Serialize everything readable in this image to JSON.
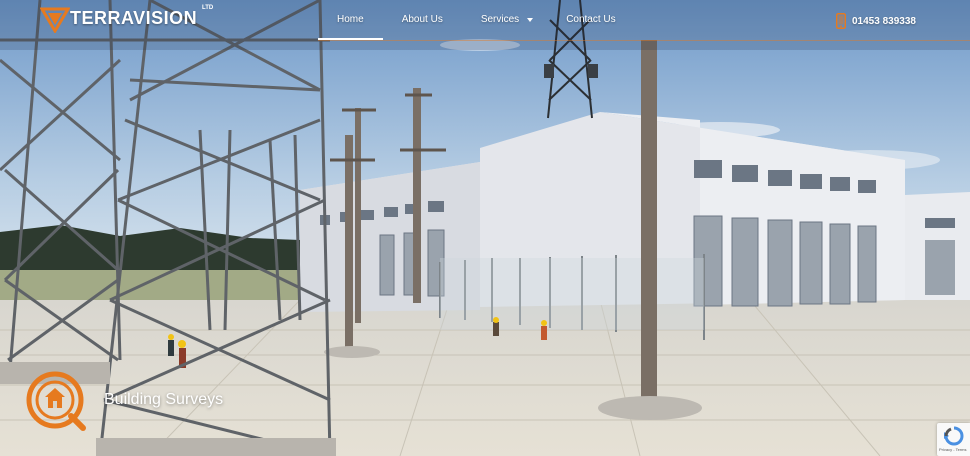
{
  "header": {
    "logo": {
      "name": "TERRAVISION",
      "suffix": "LTD",
      "tagline": ""
    },
    "nav": [
      {
        "label": "Home",
        "active": true
      },
      {
        "label": "About Us",
        "active": false
      },
      {
        "label": "Services",
        "active": false,
        "has_dropdown": true
      },
      {
        "label": "Contact Us",
        "active": false
      }
    ],
    "phone": {
      "number": "01453 839338",
      "icon": "phone-icon"
    }
  },
  "hero": {
    "service_title": "Building Surveys",
    "service_icon": "house-search-icon"
  },
  "recaptcha": {
    "text": "Privacy - Terms"
  },
  "colors": {
    "accent": "#e67a1f",
    "sky": "#8fb4d8",
    "ground": "#d9d4c7",
    "building": "#e3e5ea"
  }
}
